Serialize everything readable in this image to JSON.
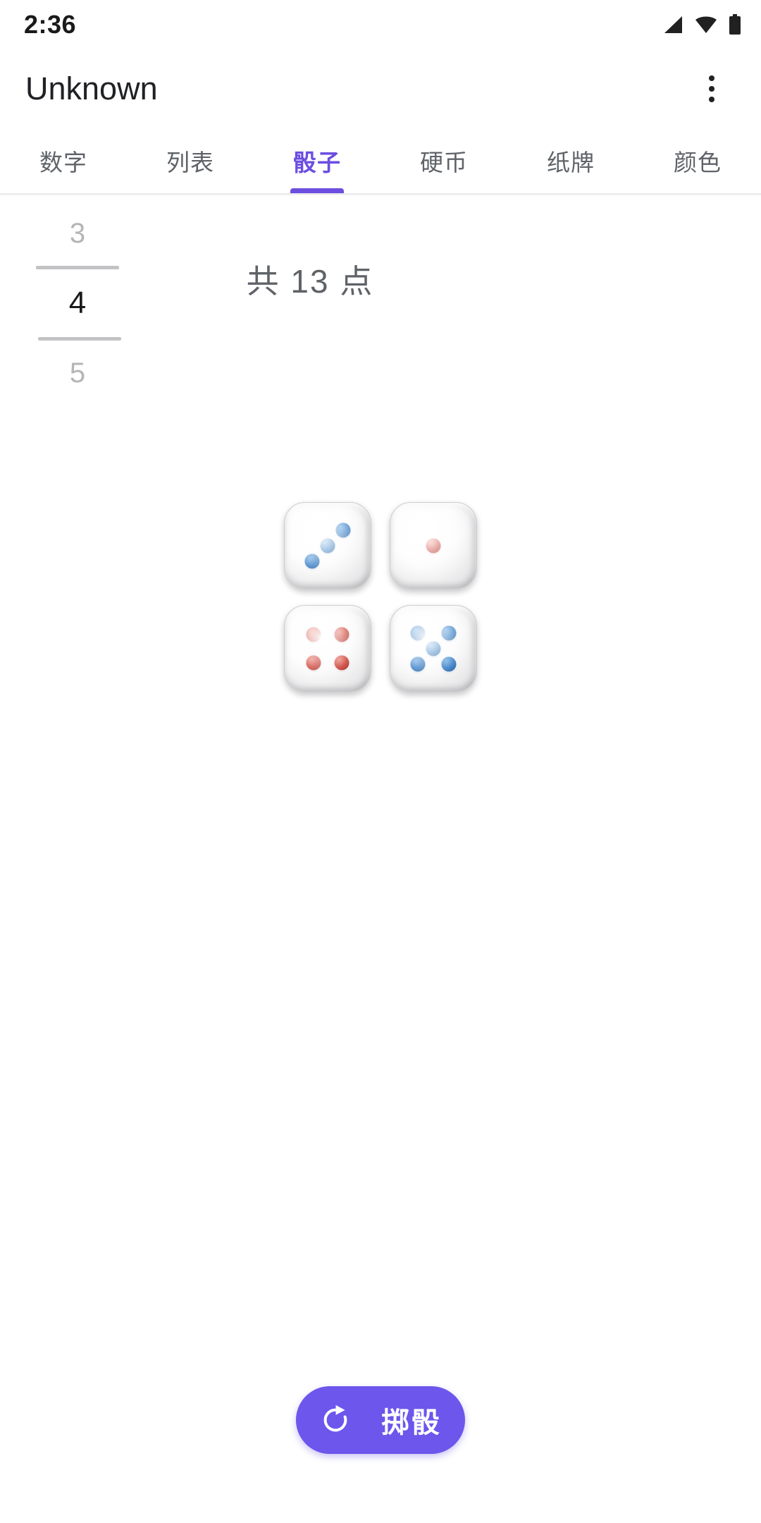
{
  "status_bar": {
    "time": "2:36",
    "icons": [
      "signal-icon",
      "wifi-icon",
      "battery-icon"
    ]
  },
  "app_bar": {
    "title": "Unknown",
    "overflow_icon": "more-vert-icon"
  },
  "tabs": [
    {
      "label": "数字",
      "active": false
    },
    {
      "label": "列表",
      "active": false
    },
    {
      "label": "骰子",
      "active": true
    },
    {
      "label": "硬币",
      "active": false
    },
    {
      "label": "纸牌",
      "active": false
    },
    {
      "label": "颜色",
      "active": false
    }
  ],
  "dice_count_picker": {
    "previous": "3",
    "selected": "4",
    "next": "5"
  },
  "total_label": "共 13 点",
  "dice": [
    {
      "value": 3,
      "pip_color": "blue"
    },
    {
      "value": 1,
      "pip_color": "red"
    },
    {
      "value": 4,
      "pip_color": "red"
    },
    {
      "value": 5,
      "pip_color": "blue"
    }
  ],
  "roll_button": {
    "label": "掷骰",
    "icon": "refresh-icon"
  },
  "colors": {
    "accent": "#6c4ee0",
    "button": "#6c56ec",
    "pip_blue": "#1f6fc0",
    "pip_red": "#c5281c",
    "text_muted": "#5f6368"
  }
}
